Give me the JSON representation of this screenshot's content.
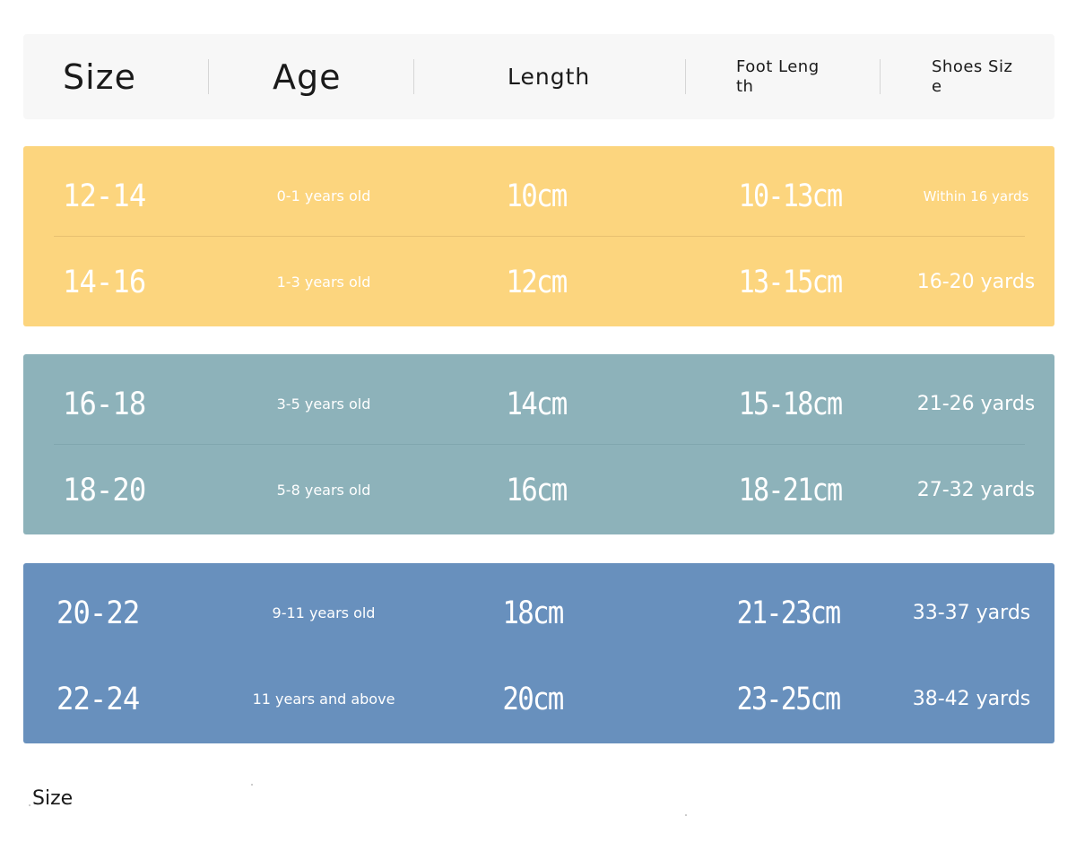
{
  "header": {
    "size": "Size",
    "age": "Age",
    "length": "Length",
    "foot_length": "Foot Length",
    "shoes_size": "Shoes Size"
  },
  "colors": {
    "group_1": "#fcd57e",
    "group_2": "#8db2ba",
    "group_3": "#6890bd",
    "header_bg": "#f7f7f7"
  },
  "groups": [
    {
      "rows": [
        {
          "size": "12-14",
          "age": "0-1 years old",
          "length": "10cm",
          "foot_length": "10-13cm",
          "shoes_size": "Within 16 yards"
        },
        {
          "size": "14-16",
          "age": "1-3 years old",
          "length": "12cm",
          "foot_length": "13-15cm",
          "shoes_size": "16-20 yards"
        }
      ]
    },
    {
      "rows": [
        {
          "size": "16-18",
          "age": "3-5 years old",
          "length": "14cm",
          "foot_length": "15-18cm",
          "shoes_size": "21-26 yards"
        },
        {
          "size": "18-20",
          "age": "5-8 years old",
          "length": "16cm",
          "foot_length": "18-21cm",
          "shoes_size": "27-32 yards"
        }
      ]
    },
    {
      "rows": [
        {
          "size": "20-22",
          "age": "9-11 years old",
          "length": "18cm",
          "foot_length": "21-23cm",
          "shoes_size": "33-37 yards"
        },
        {
          "size": "22-24",
          "age": "11 years and above",
          "length": "20cm",
          "foot_length": "23-25cm",
          "shoes_size": "38-42 yards"
        }
      ]
    }
  ],
  "footer": {
    "label": "Size"
  }
}
